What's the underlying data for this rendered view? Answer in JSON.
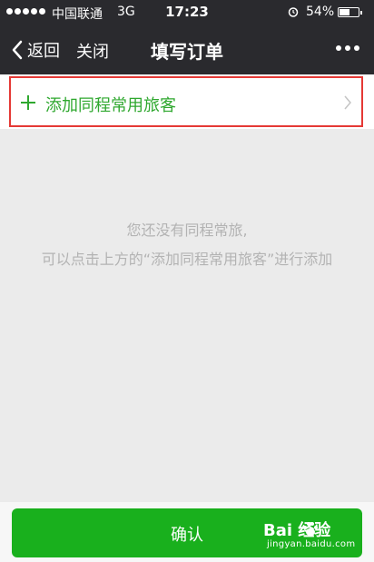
{
  "status_bar": {
    "carrier": "中国联通",
    "network": "3G",
    "time": "17:23",
    "battery_pct": "54%",
    "battery_level": 0.54
  },
  "nav": {
    "back_label": "返回",
    "close_label": "关闭",
    "title": "填写订单"
  },
  "add_passenger": {
    "label": "添加同程常用旅客"
  },
  "empty_state": {
    "line1": "您还没有同程常旅,",
    "line2": "可以点击上方的“添加同程常用旅客”进行添加"
  },
  "confirm_button": {
    "label": "确认"
  },
  "watermark": {
    "brand": "Bai  经验",
    "url": "jingyan.baidu.com"
  },
  "colors": {
    "header_bg": "#2a2a2e",
    "accent_green": "#2fa82f",
    "button_green": "#19b01d",
    "highlight_red": "#e53935"
  }
}
